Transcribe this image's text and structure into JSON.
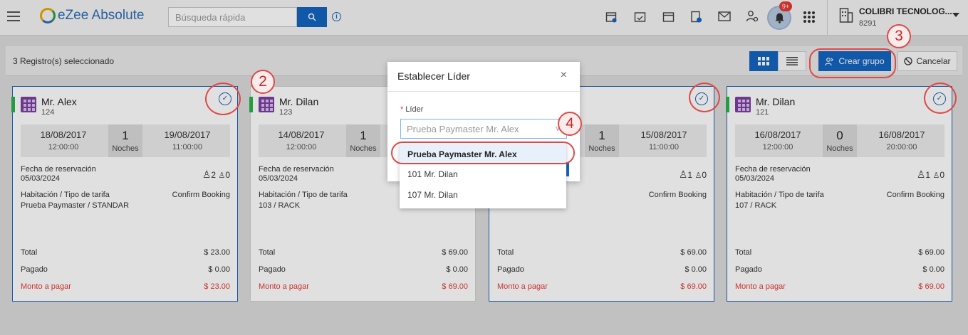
{
  "app": {
    "logo_text": "eZee Absolute",
    "search_placeholder": "Búsqueda rápida",
    "notification_badge": "9+",
    "company_name": "COLIBRI TECNOLOG...",
    "company_code": "8291"
  },
  "toolbar": {
    "selected_count": "3 Registro(s) seleccionado",
    "create_group_label": "Crear grupo",
    "cancel_label": "Cancelar"
  },
  "cards": [
    {
      "guest": "Mr. Alex",
      "room": "124",
      "checkin_date": "18/08/2017",
      "checkin_time": "12:00:00",
      "nights": "1",
      "nights_label": "Noches",
      "checkout_date": "19/08/2017",
      "checkout_time": "11:00:00",
      "reservation_label": "Fecha de reservación",
      "reservation_date": "05/03/2024",
      "adults": "2",
      "children": "0",
      "room_label": "Habitación / Tipo de tarifa",
      "room_value": "Prueba Paymaster / STANDAR",
      "status": "Confirm Booking",
      "total_label": "Total",
      "total": "$ 23.00",
      "paid_label": "Pagado",
      "paid": "$ 0.00",
      "due_label": "Monto a pagar",
      "due": "$ 23.00",
      "selected": true
    },
    {
      "guest": "Mr. Dilan",
      "room": "123",
      "checkin_date": "14/08/2017",
      "checkin_time": "12:00:00",
      "nights": "1",
      "nights_label": "Noches",
      "checkout_date": "",
      "checkout_time": "",
      "reservation_label": "Fecha de reservación",
      "reservation_date": "05/03/2024",
      "adults": "",
      "children": "",
      "room_label": "Habitación / Tipo de tarifa",
      "room_value": "103 / RACK",
      "status": "",
      "total_label": "Total",
      "total": "$ 69.00",
      "paid_label": "Pagado",
      "paid": "$ 0.00",
      "due_label": "Monto a pagar",
      "due": "$ 69.00",
      "selected": false
    },
    {
      "guest": "",
      "room": "",
      "checkin_date": "",
      "checkin_time": "",
      "nights": "1",
      "nights_label": "Noches",
      "checkout_date": "15/08/2017",
      "checkout_time": "11:00:00",
      "reservation_label": "",
      "reservation_date": "",
      "adults": "1",
      "children": "0",
      "room_label": "",
      "room_value": "",
      "status": "Confirm Booking",
      "total_label": "Total",
      "total": "$ 69.00",
      "paid_label": "Pagado",
      "paid": "$ 0.00",
      "due_label": "Monto a pagar",
      "due": "$ 69.00",
      "selected": true
    },
    {
      "guest": "Mr. Dilan",
      "room": "121",
      "checkin_date": "16/08/2017",
      "checkin_time": "12:00:00",
      "nights": "0",
      "nights_label": "Noches",
      "checkout_date": "16/08/2017",
      "checkout_time": "20:00:00",
      "reservation_label": "Fecha de reservación",
      "reservation_date": "05/03/2024",
      "adults": "1",
      "children": "0",
      "room_label": "Habitación / Tipo de tarifa",
      "room_value": "107 / RACK",
      "status": "Confirm Booking",
      "total_label": "Total",
      "total": "$ 69.00",
      "paid_label": "Pagado",
      "paid": "$ 0.00",
      "due_label": "Monto a pagar",
      "due": "$ 69.00",
      "selected": true
    }
  ],
  "modal": {
    "title": "Establecer Líder",
    "close": "×",
    "field_required": "*",
    "field_label": "Líder",
    "select_value": "Prueba Paymaster Mr. Alex",
    "options": [
      "Prueba Paymaster Mr. Alex",
      "101 Mr. Dilan",
      "107 Mr. Dilan"
    ]
  },
  "annotations": [
    "2",
    "3",
    "4"
  ],
  "colors": {
    "primary": "#1565c0",
    "annotation": "#e04848",
    "due": "#e53935",
    "occupied": "#2bb24c",
    "room_icon": "#7b3fa0"
  }
}
